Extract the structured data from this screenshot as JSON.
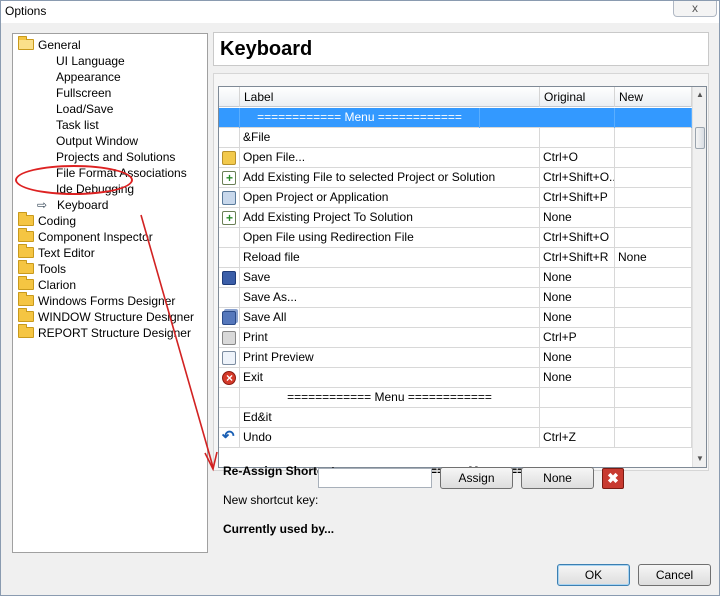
{
  "window": {
    "title": "Options",
    "close_glyph": "x"
  },
  "tree": {
    "items": [
      {
        "label": "General",
        "icon": "folder-open-icon",
        "level": 0
      },
      {
        "label": "UI Language",
        "level": 1
      },
      {
        "label": "Appearance",
        "level": 1
      },
      {
        "label": "Fullscreen",
        "level": 1
      },
      {
        "label": "Load/Save",
        "level": 1
      },
      {
        "label": "Task list",
        "level": 1
      },
      {
        "label": "Output Window",
        "level": 1
      },
      {
        "label": "Projects and Solutions",
        "level": 1
      },
      {
        "label": "File Format Associations",
        "level": 1
      },
      {
        "label": "Ide Debugging",
        "level": 1
      },
      {
        "label": "Keyboard",
        "level": 1,
        "icon": "arrow-right-icon"
      },
      {
        "label": "Coding",
        "icon": "folder-icon",
        "level": 0
      },
      {
        "label": "Component Inspector",
        "icon": "folder-icon",
        "level": 0
      },
      {
        "label": "Text Editor",
        "icon": "folder-icon",
        "level": 0
      },
      {
        "label": "Tools",
        "icon": "folder-icon",
        "level": 0
      },
      {
        "label": "Clarion",
        "icon": "folder-icon",
        "level": 0
      },
      {
        "label": "Windows Forms Designer",
        "icon": "folder-icon",
        "level": 0
      },
      {
        "label": "WINDOW Structure Designer",
        "icon": "folder-icon",
        "level": 0
      },
      {
        "label": "REPORT Structure Designer",
        "icon": "folder-icon",
        "level": 0
      }
    ]
  },
  "header": {
    "title": "Keyboard"
  },
  "grid": {
    "columns": [
      "Label",
      "Original",
      "New"
    ],
    "rows": [
      {
        "icon": "",
        "label": "============ Menu ============",
        "original": "",
        "new": "",
        "selected": true,
        "center": true
      },
      {
        "icon": "",
        "label": "&File",
        "original": "",
        "new": ""
      },
      {
        "icon": "open-file-icon",
        "label": "Open File...",
        "original": "Ctrl+O",
        "new": ""
      },
      {
        "icon": "add-file-icon",
        "label": "Add Existing File to selected Project or Solution",
        "original": "Ctrl+Shift+O...",
        "new": ""
      },
      {
        "icon": "open-project-icon",
        "label": "Open Project or Application",
        "original": "Ctrl+Shift+P",
        "new": ""
      },
      {
        "icon": "add-project-icon",
        "label": "Add Existing Project To Solution",
        "original": "None",
        "new": ""
      },
      {
        "icon": "",
        "label": "Open File using Redirection File",
        "original": "Ctrl+Shift+O",
        "new": ""
      },
      {
        "icon": "",
        "label": "Reload file",
        "original": "Ctrl+Shift+R",
        "new": "None"
      },
      {
        "icon": "save-icon",
        "label": "Save",
        "original": "None",
        "new": ""
      },
      {
        "icon": "",
        "label": "Save As...",
        "original": "None",
        "new": ""
      },
      {
        "icon": "save-all-icon",
        "label": "Save All",
        "original": "None",
        "new": ""
      },
      {
        "icon": "print-icon",
        "label": "Print",
        "original": "Ctrl+P",
        "new": ""
      },
      {
        "icon": "print-preview-icon",
        "label": "Print Preview",
        "original": "None",
        "new": ""
      },
      {
        "icon": "exit-icon",
        "label": "Exit",
        "original": "None",
        "new": ""
      },
      {
        "icon": "",
        "label": "============ Menu ============",
        "original": "",
        "new": "",
        "center": true
      },
      {
        "icon": "",
        "label": "Ed&it",
        "original": "",
        "new": ""
      },
      {
        "icon": "undo-icon",
        "label": "Undo",
        "original": "Ctrl+Z",
        "new": ""
      }
    ]
  },
  "reassign": {
    "label": "Re-Assign Shortcut :",
    "current_command": "============ Menu ============",
    "new_key_label": "New shortcut key:",
    "new_key_value": "",
    "assign_label": "Assign",
    "none_label": "None",
    "clear_glyph": "✖",
    "currently_used_label": "Currently used by..."
  },
  "footer": {
    "ok_label": "OK",
    "cancel_label": "Cancel"
  },
  "colors": {
    "selection": "#3399ff",
    "annotation": "#d22222"
  }
}
